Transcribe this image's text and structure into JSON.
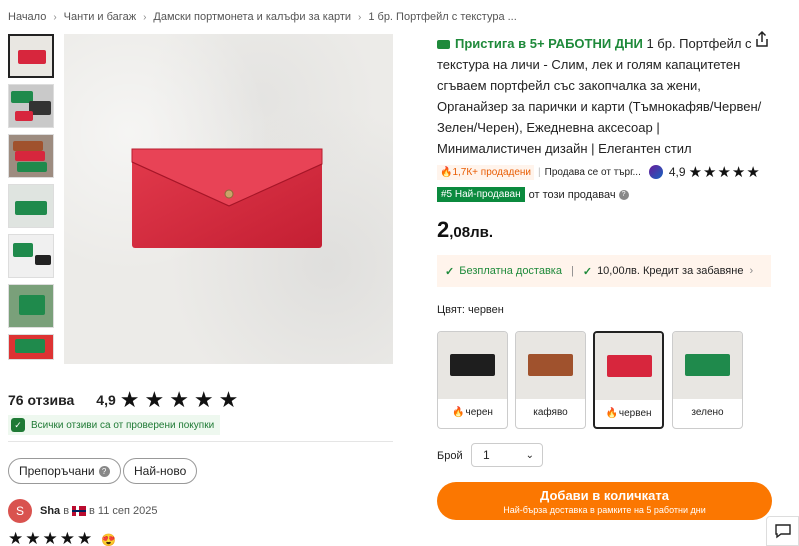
{
  "breadcrumb": {
    "items": [
      "Начало",
      "Чанти и багаж",
      "Дамски портмонета и калъфи за карти",
      "1 бр. Портфейл с текстура ..."
    ]
  },
  "product": {
    "delivery_label": "Пристига в 5+ РАБОТНИ ДНИ",
    "title": "1 бр. Портфейл с текстура на личи - Слим, лек и голям капацитетен сгъваем портфейл със закопчалка за жени, Органайзер за парички и карти (Тъмнокафяв/Червен/Зелен/Черен), Ежедневна аксесоар | Минималистичен дизайн | Елегантен стил",
    "sold_badge": "1,7К+ продадени",
    "seller_text": "Продава се от търг...",
    "seller_rating": "4,9",
    "stars": "★★★★★",
    "best_badge": "#5 Най-продаван",
    "best_suffix": "от този продавач",
    "price_int": "2",
    "price_frac": ",08лв.",
    "promo_free": "Безплатна доставка",
    "promo_credit": "10,00лв. Кредит за забавяне",
    "color_label": "Цвят: червен",
    "colors": [
      {
        "label": "черен",
        "hot": true,
        "hex": "#1e1e1e"
      },
      {
        "label": "кафяво",
        "hot": false,
        "hex": "#a0522d"
      },
      {
        "label": "червен",
        "hot": true,
        "hex": "#d7263d"
      },
      {
        "label": "зелено",
        "hot": false,
        "hex": "#1f8a4c"
      }
    ],
    "selected_color_index": 2,
    "qty_label": "Брой",
    "qty_value": "1",
    "add_button": "Добави в количката",
    "add_sub": "Най-бърза доставка в рамките на 5 работни дни"
  },
  "reviews": {
    "count_label": "76 отзива",
    "rating": "4,9",
    "stars": "★★★★★",
    "verified_text": "Всички отзиви са от проверени покупки",
    "filters": [
      "Препоръчани",
      "Най-ново"
    ],
    "first_review": {
      "avatar_letter": "S",
      "name": "Sha",
      "in_word": "в",
      "date": "в 11 сеп 2025",
      "stars": "★★★★★",
      "emoji": "😍"
    }
  },
  "colors": {
    "accent_orange": "#fb7701",
    "green": "#1f8a3b",
    "wallet_red": "#d7263d"
  }
}
